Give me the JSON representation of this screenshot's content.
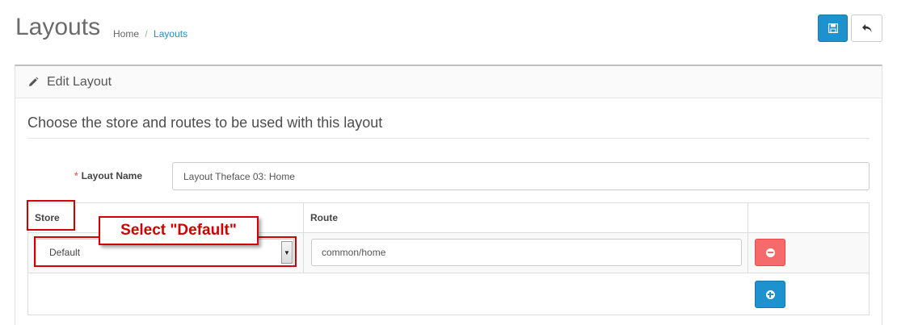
{
  "header": {
    "title": "Layouts",
    "breadcrumb": {
      "home": "Home",
      "separator": "/",
      "current": "Layouts"
    }
  },
  "toolbar": {
    "save_icon": "floppy-disk-icon",
    "back_icon": "reply-arrow-icon"
  },
  "panel": {
    "heading_icon": "pencil-icon",
    "heading": "Edit Layout",
    "legend": "Choose the store and routes to be used with this layout"
  },
  "form": {
    "required_mark": "*",
    "layout_name_label": "Layout Name",
    "layout_name_value": "Layout Theface 03: Home"
  },
  "routes_table": {
    "headers": {
      "store": "Store",
      "route": "Route"
    },
    "rows": [
      {
        "store": "Default",
        "route": "common/home"
      }
    ]
  },
  "annotation": {
    "callout": "Select \"Default\"",
    "color": "#d40000"
  },
  "colors": {
    "primary": "#1e91cf",
    "danger": "#f56b6b"
  }
}
